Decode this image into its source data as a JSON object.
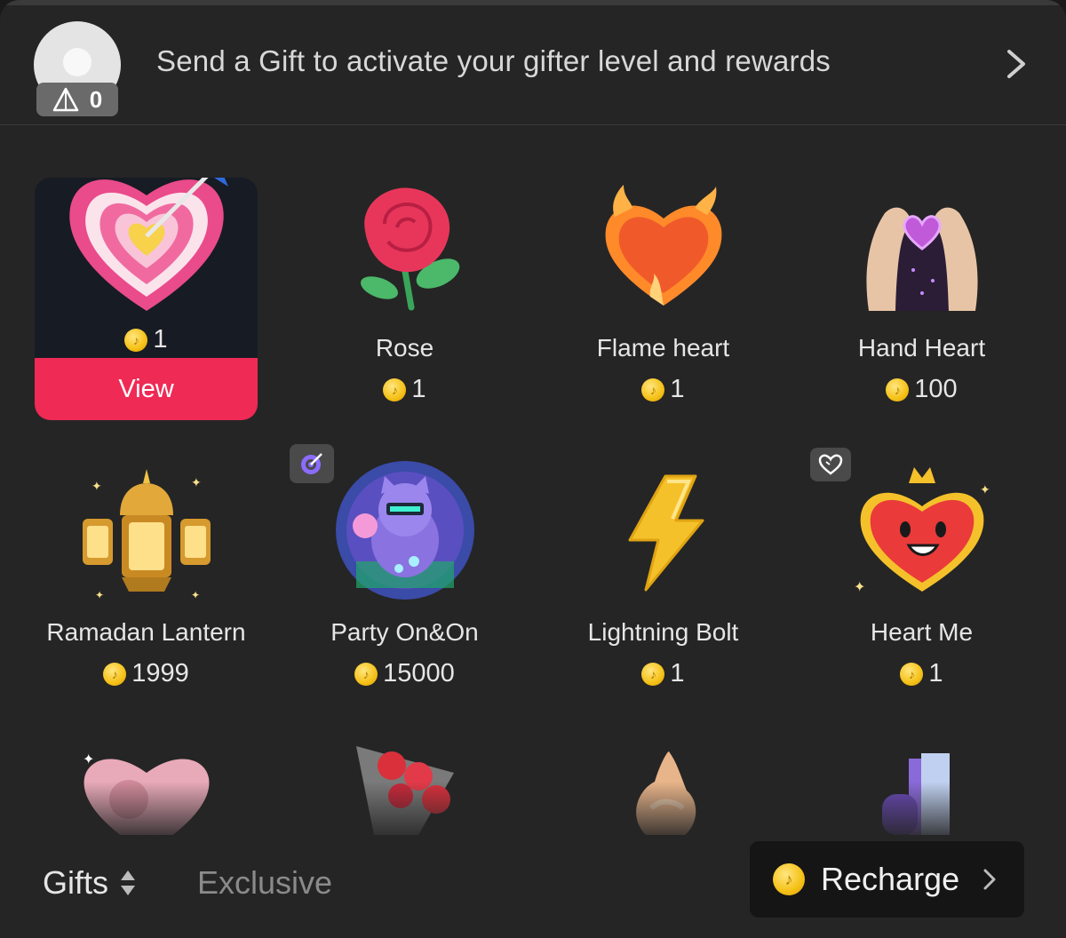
{
  "header": {
    "level_value": "0",
    "message": "Send a Gift to activate your gifter level and rewards"
  },
  "gifts": [
    {
      "name": "",
      "price": "1",
      "action": "View",
      "icon": "heart-target-icon"
    },
    {
      "name": "Rose",
      "price": "1",
      "icon": "rose-icon"
    },
    {
      "name": "Flame heart",
      "price": "1",
      "icon": "flame-heart-icon"
    },
    {
      "name": "Hand Heart",
      "price": "100",
      "icon": "hand-heart-icon"
    },
    {
      "name": "Ramadan Lantern",
      "price": "1999",
      "icon": "lantern-icon"
    },
    {
      "name": "Party On&On",
      "price": "15000",
      "icon": "party-cat-icon",
      "tag": "target-tag-icon"
    },
    {
      "name": "Lightning Bolt",
      "price": "1",
      "icon": "lightning-icon"
    },
    {
      "name": "Heart Me",
      "price": "1",
      "icon": "heart-me-icon",
      "tag": "heart-tag-icon"
    }
  ],
  "footer": {
    "tab_gifts": "Gifts",
    "tab_exclusive": "Exclusive",
    "recharge_label": "Recharge"
  },
  "colors": {
    "panel": "#252525",
    "accent": "#ef2a55",
    "coin": "#f5c116"
  }
}
